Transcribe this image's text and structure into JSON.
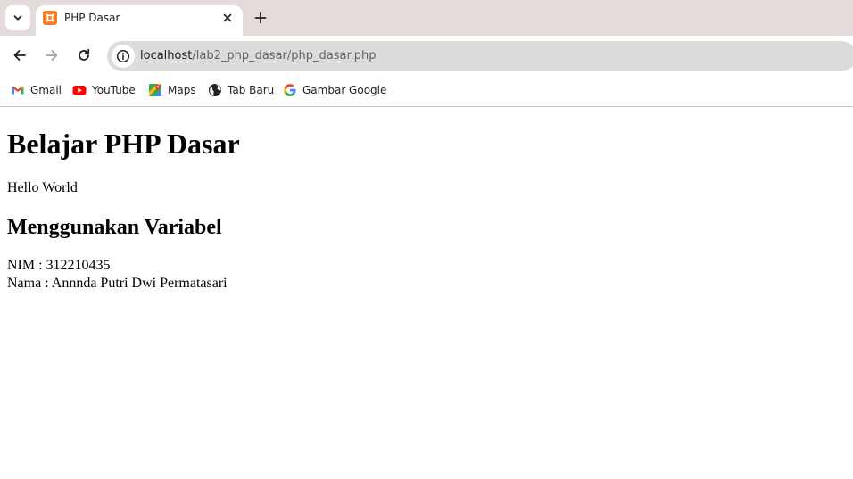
{
  "browser": {
    "tab": {
      "title": "PHP Dasar",
      "favicon": "xampp-icon"
    },
    "address_bar": {
      "host": "localhost",
      "path": "/lab2_php_dasar/php_dasar.php"
    },
    "bookmarks": [
      {
        "label": "Gmail",
        "icon": "gmail-icon"
      },
      {
        "label": "YouTube",
        "icon": "youtube-icon"
      },
      {
        "label": "Maps",
        "icon": "maps-icon"
      },
      {
        "label": "Tab Baru",
        "icon": "globe-icon"
      },
      {
        "label": "Gambar Google",
        "icon": "google-icon"
      }
    ],
    "colors": {
      "tabstrip": "#e3dcda",
      "omnibox": "#dedcdb",
      "xampp_orange": "#fb7a24"
    }
  },
  "page": {
    "heading": "Belajar PHP Dasar",
    "greeting": "Hello World",
    "subheading": "Menggunakan Variabel",
    "nim_line": "NIM : 312210435",
    "nama_line": "Nama : Annnda Putri Dwi Permatasari"
  }
}
